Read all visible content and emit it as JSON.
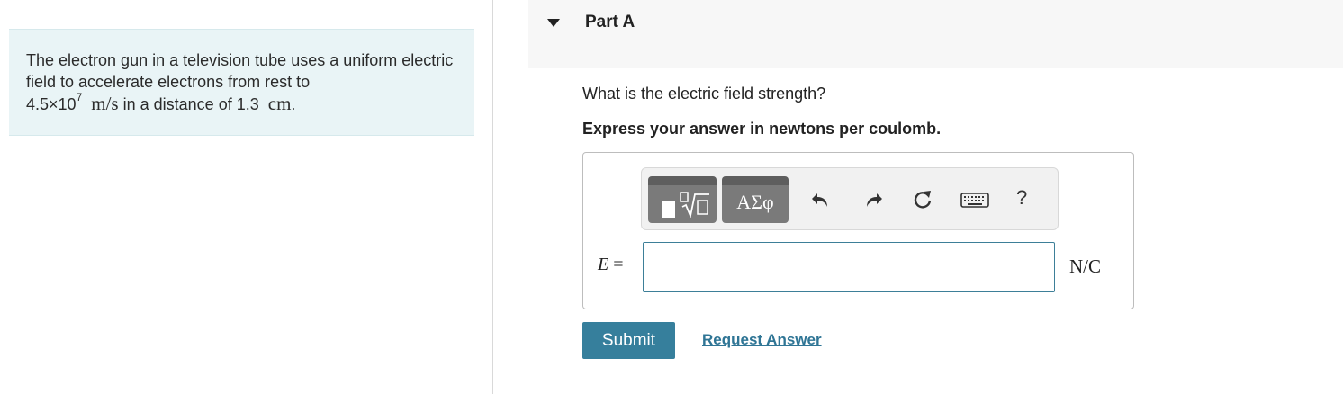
{
  "problem": {
    "text_1": "The electron gun in a television tube uses a uniform electric field to accelerate electrons from rest to",
    "speed_mantissa": "4.5×10",
    "speed_exponent": "7",
    "speed_unit": "m/s",
    "text_2": "in a distance of",
    "distance_value": "1.3",
    "distance_unit": "cm",
    "period": "."
  },
  "part": {
    "title": "Part A",
    "question": "What is the electric field strength?",
    "instruction": "Express your answer in newtons per coulomb."
  },
  "toolbar": {
    "templates_icon": "square-root-template-icon",
    "symbols_label": "ΑΣφ",
    "undo_icon": "undo-icon",
    "redo_icon": "redo-icon",
    "reset_icon": "reset-icon",
    "keyboard_icon": "keyboard-icon",
    "help_label": "?"
  },
  "answer": {
    "variable": "E",
    "equals": "=",
    "value": "",
    "unit": "N/C"
  },
  "actions": {
    "submit_label": "Submit",
    "request_answer_label": "Request Answer"
  },
  "colors": {
    "panel_bg": "#e9f4f6",
    "accent": "#367f9c",
    "link": "#2f7595",
    "header_bg": "#f7f7f7"
  }
}
